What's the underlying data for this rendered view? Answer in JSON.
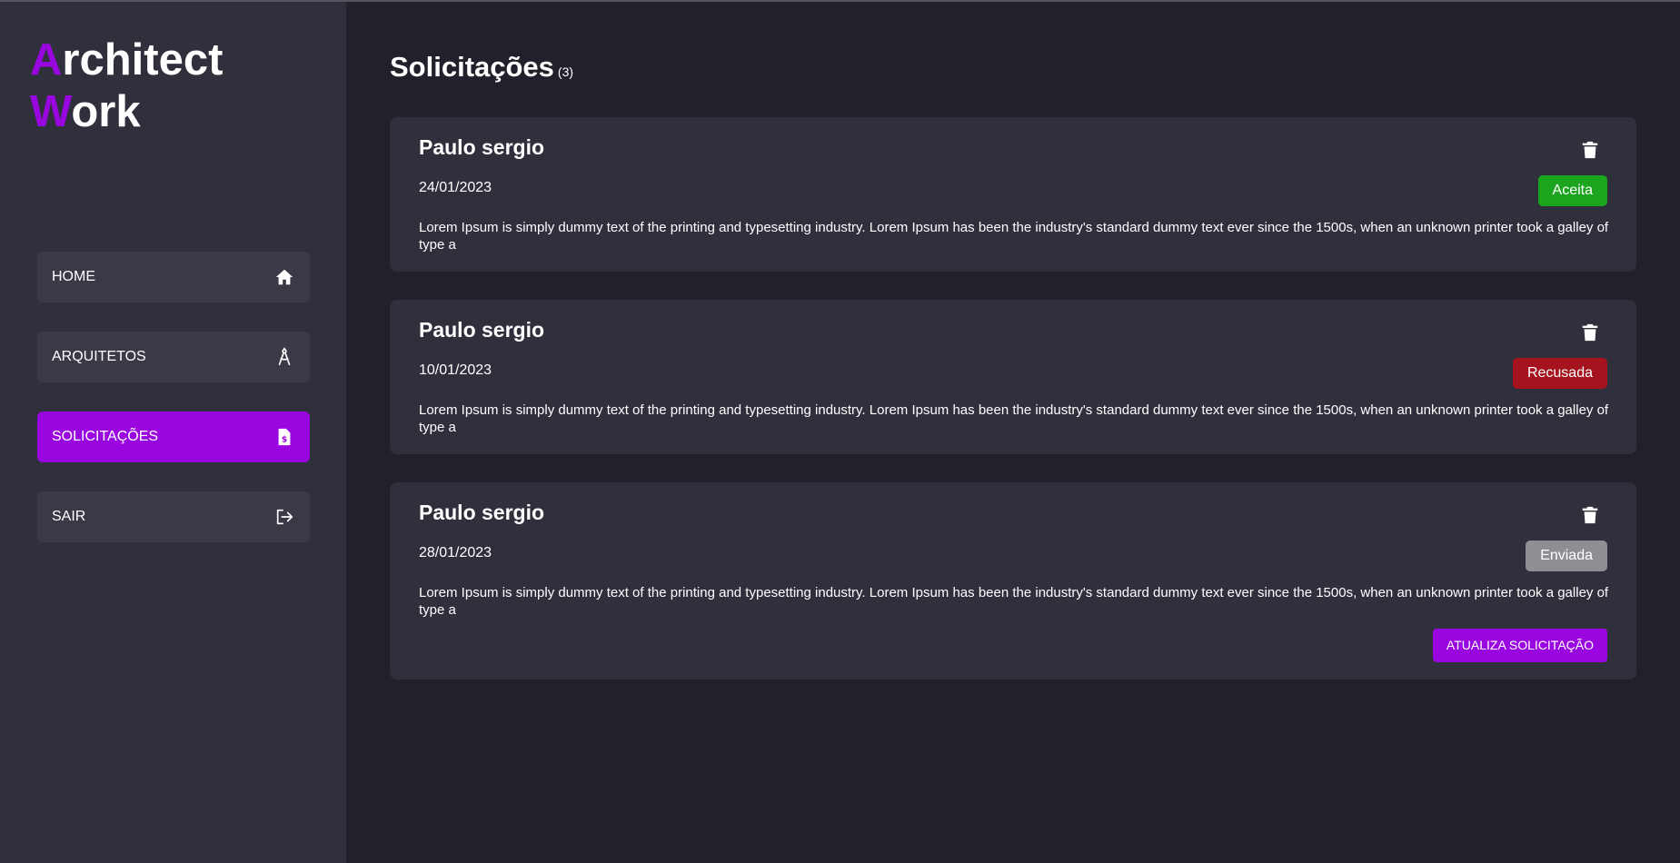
{
  "app": {
    "logo_line1_initial": "A",
    "logo_line1_rest": "rchitect",
    "logo_line2_initial": "W",
    "logo_line2_rest": "ork",
    "accent_color": "#9a06e0"
  },
  "sidebar": {
    "items": [
      {
        "label": "HOME",
        "icon": "home-icon",
        "active": false
      },
      {
        "label": "ARQUITETOS",
        "icon": "compass-icon",
        "active": false
      },
      {
        "label": "SOLICITAÇÕES",
        "icon": "file-dollar-icon",
        "active": true
      },
      {
        "label": "SAIR",
        "icon": "logout-icon",
        "active": false
      }
    ]
  },
  "main": {
    "title": "Solicitações",
    "count": "(3)",
    "requests": [
      {
        "name": "Paulo sergio",
        "date": "24/01/2023",
        "status": "Aceita",
        "status_color": "#1ba51f",
        "description": "Lorem Ipsum is simply dummy text of the printing and typesetting industry. Lorem Ipsum has been the industry's standard dummy text ever since the 1500s, when an unknown printer took a galley of type a"
      },
      {
        "name": "Paulo sergio",
        "date": "10/01/2023",
        "status": "Recusada",
        "status_color": "#a5141e",
        "description": "Lorem Ipsum is simply dummy text of the printing and typesetting industry. Lorem Ipsum has been the industry's standard dummy text ever since the 1500s, when an unknown printer took a galley of type a"
      },
      {
        "name": "Paulo sergio",
        "date": "28/01/2023",
        "status": "Enviada",
        "status_color": "#8e8e94",
        "description": "Lorem Ipsum is simply dummy text of the printing and typesetting industry. Lorem Ipsum has been the industry's standard dummy text ever since the 1500s, when an unknown printer took a galley of type a",
        "action_label": "ATUALIZA SOLICITAÇÃO"
      }
    ]
  }
}
